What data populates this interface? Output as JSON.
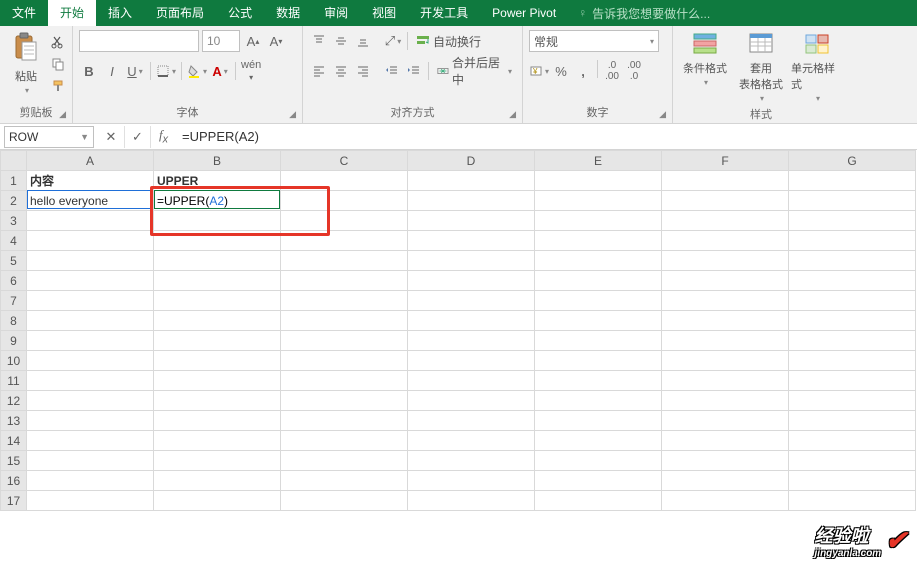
{
  "tabs": {
    "file": "文件",
    "home": "开始",
    "insert": "插入",
    "layout": "页面布局",
    "formula": "公式",
    "data": "数据",
    "review": "审阅",
    "view": "视图",
    "dev": "开发工具",
    "powerpivot": "Power Pivot",
    "tellme": "告诉我您想要做什么..."
  },
  "ribbon": {
    "clipboard": {
      "paste": "粘贴",
      "label": "剪贴板"
    },
    "font": {
      "size": "10",
      "label": "字体"
    },
    "align": {
      "wrap": "自动换行",
      "merge": "合并后居中",
      "label": "对齐方式"
    },
    "number": {
      "format": "常规",
      "label": "数字"
    },
    "styles": {
      "cond": "条件格式",
      "table": "套用\n表格格式",
      "cell": "单元格样式",
      "label": "样式"
    }
  },
  "namebox": "ROW",
  "formula_bar": "=UPPER(A2)",
  "columns": [
    "A",
    "B",
    "C",
    "D",
    "E",
    "F",
    "G"
  ],
  "rows": [
    "1",
    "2",
    "3",
    "4",
    "5",
    "6",
    "7",
    "8",
    "9",
    "10",
    "11",
    "12",
    "13",
    "14",
    "15",
    "16",
    "17"
  ],
  "cells": {
    "A1": "内容",
    "B1": "UPPER",
    "A2": "hello everyone",
    "B2_prefix": "=UPPER(",
    "B2_ref": "A2",
    "B2_suffix": ")"
  },
  "watermark": {
    "main": "经验啦",
    "sub": "jingyanla.com"
  }
}
